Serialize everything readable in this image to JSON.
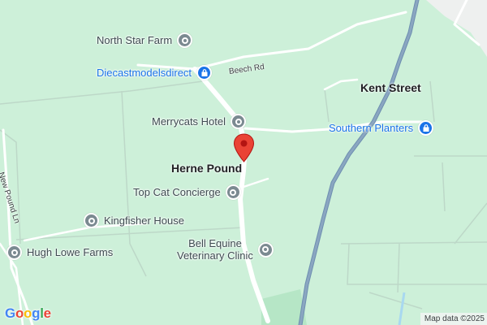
{
  "map": {
    "background": "#cdf0d9",
    "places": {
      "herne_pound": "Herne Pound",
      "kent_street": "Kent Street"
    },
    "roads": {
      "beech_rd": "Beech Rd",
      "new_pound_ln": "New Pound Ln"
    },
    "pois": {
      "north_star_farm": "North Star Farm",
      "diecastmodelsdirect": "Diecastmodelsdirect",
      "merrycats_hotel": "Merrycats Hotel",
      "southern_planters": "Southern Planters",
      "top_cat_concierge": "Top Cat Concierge",
      "kingfisher_house": "Kingfisher House",
      "hugh_lowe_farms": "Hugh Lowe Farms",
      "bell_equine_line1": "Bell Equine",
      "bell_equine_line2": "Veterinary Clinic"
    },
    "icons": {
      "generic_poi": "pin-icon",
      "shopping": "shopping-bag-icon",
      "location_marker": "red-marker-icon"
    },
    "colors": {
      "highway": "#8aa6c1",
      "minor_road": "#ffffff",
      "shopping": "#1a73e8",
      "marker": "#ea4335"
    }
  },
  "footer": {
    "logo_letters": [
      "G",
      "o",
      "o",
      "g",
      "l",
      "e"
    ],
    "attribution": "Map data ©2025"
  }
}
